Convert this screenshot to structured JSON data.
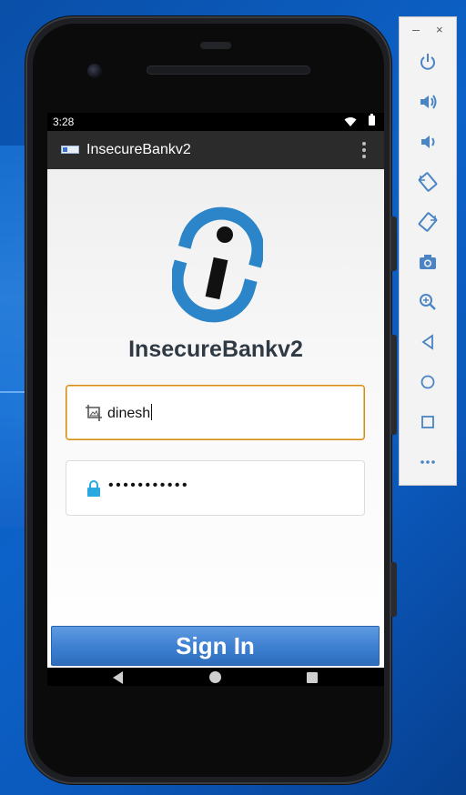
{
  "status_bar": {
    "time": "3:28"
  },
  "app": {
    "title": "InsecureBankv2",
    "brand_name": "InsecureBankv2"
  },
  "login": {
    "username_value": "dinesh",
    "password_value": "•••••••••••",
    "signin_label": "Sign In"
  },
  "emulator_toolbar": {
    "window_controls": [
      "minimize-icon",
      "close-icon"
    ],
    "close_glyph": "×",
    "buttons": [
      "power-icon",
      "volume-up-icon",
      "volume-down-icon",
      "rotate-left-icon",
      "rotate-right-icon",
      "screenshot-icon",
      "zoom-icon",
      "back-icon",
      "home-icon",
      "overview-icon",
      "more-icon"
    ]
  },
  "colors": {
    "accent_blue": "#2b85c8",
    "focus_border": "#d28b1a",
    "button_blue": "#3d7fd0",
    "toolbar_icon": "#4a84c4"
  }
}
